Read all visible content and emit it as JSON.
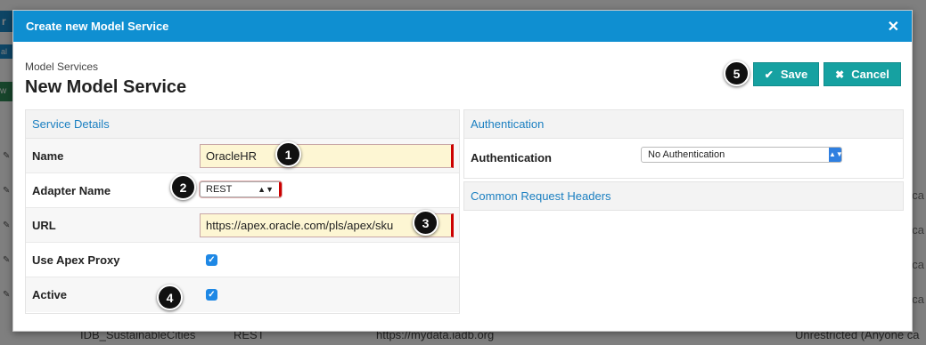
{
  "background": {
    "tab1": "r L",
    "tab2": "al S",
    "tab3": "w",
    "right_texts": [
      "ca",
      "ca",
      "ca",
      "ca",
      "ca",
      "ca"
    ],
    "bottom_row": {
      "name": "IDB_SustainableCities",
      "type": "REST",
      "url": "https://mydata.iadb.org",
      "access": "Unrestricted (Anyone ca"
    }
  },
  "dialog": {
    "title": "Create new Model Service",
    "close_icon": "close-icon"
  },
  "header": {
    "breadcrumb": "Model Services",
    "title": "New Model Service"
  },
  "buttons": {
    "save": "Save",
    "cancel": "Cancel"
  },
  "service_details": {
    "heading": "Service Details",
    "name_label": "Name",
    "name_value": "OracleHR",
    "adapter_label": "Adapter Name",
    "adapter_value": "REST",
    "url_label": "URL",
    "url_value": "https://apex.oracle.com/pls/apex/sku",
    "proxy_label": "Use Apex Proxy",
    "proxy_checked": true,
    "active_label": "Active",
    "active_checked": true
  },
  "authentication": {
    "heading": "Authentication",
    "label": "Authentication",
    "value": "No Authentication"
  },
  "common_headers": {
    "heading": "Common Request Headers"
  },
  "callouts": [
    "1",
    "2",
    "3",
    "4",
    "5"
  ],
  "colors": {
    "header_blue": "#0f8fd1",
    "button_teal": "#16a1a1",
    "required_red": "#cc0000",
    "input_yellow": "#fdf6d3"
  }
}
